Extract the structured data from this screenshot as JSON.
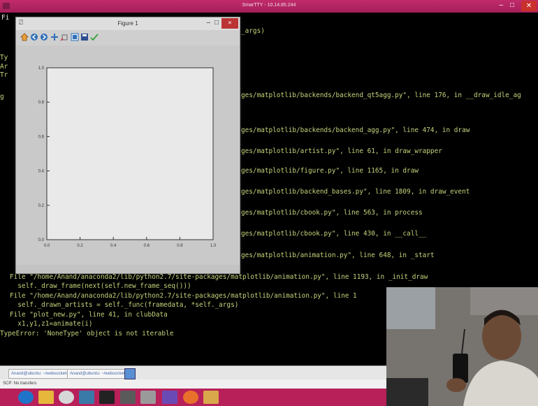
{
  "putty": {
    "title": "SmarTTY - 10.14.85.244"
  },
  "terminal": {
    "lines": [
      "_args)",
      "ges/matplotlib/backends/backend_qt5agg.py\", line 176, in __draw_idle_ag",
      "ges/matplotlib/backends/backend_agg.py\", line 474, in draw",
      "ges/matplotlib/artist.py\", line 61, in draw_wrapper",
      "ges/matplotlib/figure.py\", line 1165, in draw",
      "ges/matplotlib/backend_bases.py\", line 1809, in draw_event",
      "ges/matplotlib/cbook.py\", line 563, in process",
      "ges/matplotlib/cbook.py\", line 430, in __call__",
      "ges/matplotlib/animation.py\", line 648, in _start",
      "File \"/home/Anand/anaconda2/lib/python2.7/site-packages/matplotlib/animation.py\", line 1193, in _init_draw",
      "  self._draw_frame(next(self.new_frame_seq()))",
      "File \"/home/Anand/anaconda2/lib/python2.7/site-packages/matplotlib/animation.py\", line 1",
      "  self._drawn_artists = self._func(framedata, *self._args)",
      "File \"plot_new.py\", line 41, in clubData",
      "  x1,y1,z1=animate(i)",
      "TypeError: 'NoneType' object is not iterable"
    ],
    "left_fragments": [
      "Fi",
      "Ty",
      "Ar",
      "Tr",
      "g"
    ]
  },
  "figure": {
    "title": "Figure 1",
    "toolbar_icons": [
      "home-icon",
      "back-icon",
      "forward-icon",
      "pan-icon",
      "zoom-icon",
      "subplots-icon",
      "save-icon",
      "edit-icon"
    ]
  },
  "chart_data": {
    "type": "line",
    "x": [],
    "series": [],
    "xlim": [
      0.0,
      1.0
    ],
    "ylim": [
      0.0,
      1.0
    ],
    "xticks": [
      "0.0",
      "0.2",
      "0.4",
      "0.6",
      "0.8",
      "1.0"
    ],
    "yticks": [
      "0.0",
      "0.2",
      "0.4",
      "0.6",
      "0.8",
      "1.0"
    ],
    "grid": false,
    "background": "#e9e9e9"
  },
  "tabs": [
    {
      "label": "Anand@ubuntu: ~/websockets"
    },
    {
      "label": "Anand@ubuntu: ~/websockets"
    }
  ],
  "status": {
    "text": "SCP: No transfers"
  },
  "colors": {
    "terminal_text": "#c7d27b",
    "titlebar": "#b8205a",
    "taskbar": "#b8205a",
    "plot_bg": "#e9e9e9"
  },
  "taskbar": {
    "icons": [
      "internet-explorer-icon",
      "file-explorer-icon",
      "chrome-icon",
      "matlab-icon",
      "terminal-icon",
      "window-icon",
      "app-icon",
      "visual-studio-icon",
      "firefox-icon",
      "media-icon"
    ]
  }
}
